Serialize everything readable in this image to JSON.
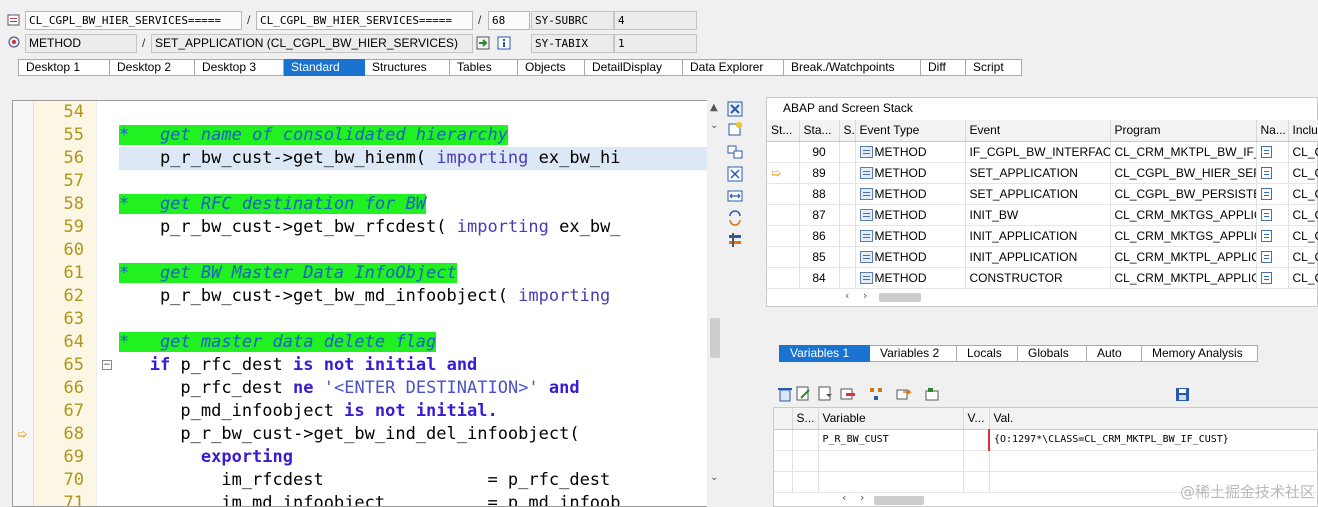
{
  "status_row1": {
    "program": "CL_CGPL_BW_HIER_SERVICES=====",
    "include": "CL_CGPL_BW_HIER_SERVICES=====",
    "line": "68",
    "sys_var1_name": "SY-SUBRC",
    "sys_var1_value": "4"
  },
  "status_row2": {
    "event_type": "METHOD",
    "event": "SET_APPLICATION (CL_CGPL_BW_HIER_SERVICES)",
    "sys_var2_name": "SY-TABIX",
    "sys_var2_value": "1"
  },
  "desktop_tabs": [
    {
      "label": "Desktop 1"
    },
    {
      "label": "Desktop 2"
    },
    {
      "label": "Desktop 3"
    },
    {
      "label": "Standard",
      "active": true
    },
    {
      "label": "Structures"
    },
    {
      "label": "Tables"
    },
    {
      "label": "Objects"
    },
    {
      "label": "DetailDisplay"
    },
    {
      "label": "Data Explorer"
    },
    {
      "label": "Break./Watchpoints"
    },
    {
      "label": "Diff"
    },
    {
      "label": "Script"
    }
  ],
  "editor": {
    "current_line": "68",
    "lines": [
      {
        "no": "54",
        "text": ""
      },
      {
        "no": "55",
        "text": "*   get name of consolidated hierarchy",
        "comment": true
      },
      {
        "no": "56",
        "pre": "    p_r_bw_cust->get_bw_hienm( ",
        "kw": "importing",
        "post": " ex_bw_hi"
      },
      {
        "no": "57",
        "text": ""
      },
      {
        "no": "58",
        "text": "*   get RFC destination for BW",
        "comment": true
      },
      {
        "no": "59",
        "pre": "    p_r_bw_cust->get_bw_rfcdest( ",
        "kw": "importing",
        "post": " ex_bw_"
      },
      {
        "no": "60",
        "text": ""
      },
      {
        "no": "61",
        "text": "*   get BW Master Data InfoObject",
        "comment": true
      },
      {
        "no": "62",
        "pre": "    p_r_bw_cust->get_bw_md_infoobject( ",
        "kw": "importing",
        "post": ""
      },
      {
        "no": "63",
        "text": ""
      },
      {
        "no": "64",
        "text": "*   get master data delete flag",
        "comment": true
      },
      {
        "no": "65",
        "code65": [
          "   ",
          "if",
          " p_rfc_dest ",
          "is not initial",
          " ",
          "and"
        ]
      },
      {
        "no": "66",
        "code66": [
          "      p_rfc_dest ",
          "ne",
          " ",
          "'<ENTER DESTINATION>'",
          " ",
          "and"
        ]
      },
      {
        "no": "67",
        "code67": [
          "      p_md_infoobject ",
          "is not initial."
        ]
      },
      {
        "no": "68",
        "text": "      p_r_bw_cust->get_bw_ind_del_infoobject("
      },
      {
        "no": "69",
        "kwonly": "        exporting"
      },
      {
        "no": "70",
        "text": "          im_rfcdest                = p_rfc_dest"
      },
      {
        "no": "71",
        "text": "          im_md_infoobject          = p_md_infoob"
      }
    ]
  },
  "stack_panel": {
    "title": "ABAP and Screen Stack",
    "columns": [
      "St...",
      "Sta...",
      "S...",
      "Event Type",
      "Event",
      "Program",
      "Na...",
      "Inclu"
    ],
    "current_row": 1,
    "rows": [
      {
        "level": "90",
        "type": "METHOD",
        "event": "IF_CGPL_BW_INTERFAC...",
        "program": "CL_CRM_MKTPL_BW_IF_...",
        "incl": "CL_C"
      },
      {
        "level": "89",
        "type": "METHOD",
        "event": "SET_APPLICATION",
        "program": "CL_CGPL_BW_HIER_SER...",
        "incl": "CL_C"
      },
      {
        "level": "88",
        "type": "METHOD",
        "event": "SET_APPLICATION",
        "program": "CL_CGPL_BW_PERSISTE...",
        "incl": "CL_C"
      },
      {
        "level": "87",
        "type": "METHOD",
        "event": "INIT_BW",
        "program": "CL_CRM_MKTGS_APPLIC...",
        "incl": "CL_C"
      },
      {
        "level": "86",
        "type": "METHOD",
        "event": "INIT_APPLICATION",
        "program": "CL_CRM_MKTGS_APPLIC...",
        "incl": "CL_C"
      },
      {
        "level": "85",
        "type": "METHOD",
        "event": "INIT_APPLICATION",
        "program": "CL_CRM_MKTPL_APPLIC...",
        "incl": "CL_C"
      },
      {
        "level": "84",
        "type": "METHOD",
        "event": "CONSTRUCTOR",
        "program": "CL_CRM_MKTPL_APPLIC...",
        "incl": "CL_C"
      }
    ]
  },
  "variable_tabs": [
    {
      "label": "Variables 1",
      "active": true
    },
    {
      "label": "Variables 2"
    },
    {
      "label": "Locals"
    },
    {
      "label": "Globals"
    },
    {
      "label": "Auto"
    },
    {
      "label": "Memory Analysis"
    }
  ],
  "variables": {
    "columns": [
      "S...",
      "Variable",
      "V...",
      "Val."
    ],
    "rows": [
      {
        "name": "P_R_BW_CUST",
        "value": "{O:1297*\\CLASS=CL_CRM_MKTPL_BW_IF_CUST}"
      }
    ]
  },
  "watermark": "@稀土掘金技术社区",
  "colors": {
    "accent": "#1a73d0",
    "comment_bg": "#21f021",
    "keyword": "#3a1ad6",
    "line_no": "#b0951a"
  }
}
